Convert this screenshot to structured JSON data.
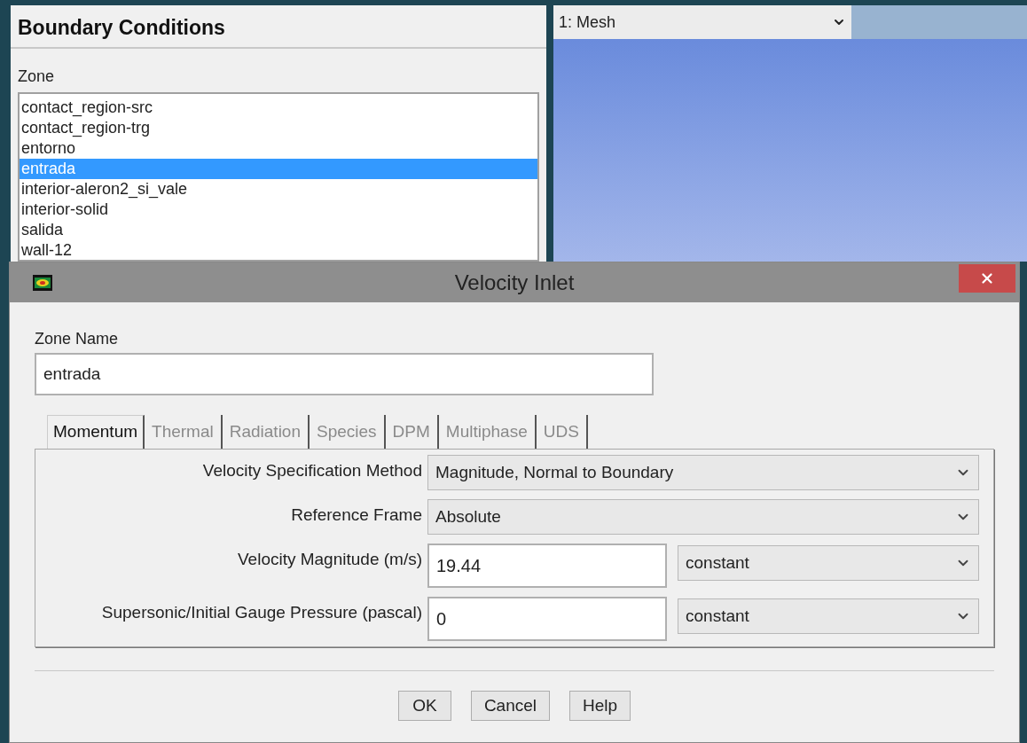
{
  "panel": {
    "title": "Boundary Conditions",
    "zone_label": "Zone",
    "zones": [
      {
        "label": "contact_region-src",
        "selected": false
      },
      {
        "label": "contact_region-trg",
        "selected": false
      },
      {
        "label": "entorno",
        "selected": false
      },
      {
        "label": "entrada",
        "selected": true
      },
      {
        "label": "interior-aleron2_si_vale",
        "selected": false
      },
      {
        "label": "interior-solid",
        "selected": false
      },
      {
        "label": "salida",
        "selected": false
      },
      {
        "label": "wall-12",
        "selected": false
      }
    ]
  },
  "graphics": {
    "window_select": "1: Mesh"
  },
  "dialog": {
    "title": "Velocity Inlet",
    "zone_name_label": "Zone Name",
    "zone_name": "entrada",
    "tabs": [
      {
        "label": "Momentum",
        "selected": true
      },
      {
        "label": "Thermal",
        "selected": false
      },
      {
        "label": "Radiation",
        "selected": false
      },
      {
        "label": "Species",
        "selected": false
      },
      {
        "label": "DPM",
        "selected": false
      },
      {
        "label": "Multiphase",
        "selected": false
      },
      {
        "label": "UDS",
        "selected": false
      }
    ],
    "fields": [
      {
        "kind": "select",
        "label": "Velocity Specification Method",
        "value": "Magnitude, Normal to Boundary"
      },
      {
        "kind": "select",
        "label": "Reference Frame",
        "value": "Absolute"
      },
      {
        "kind": "input_select",
        "label": "Velocity Magnitude (m/s)",
        "value": "19.44",
        "profile": "constant"
      },
      {
        "kind": "input_select",
        "label": "Supersonic/Initial Gauge Pressure (pascal)",
        "value": "0",
        "profile": "constant"
      }
    ],
    "buttons": [
      "OK",
      "Cancel",
      "Help"
    ]
  }
}
